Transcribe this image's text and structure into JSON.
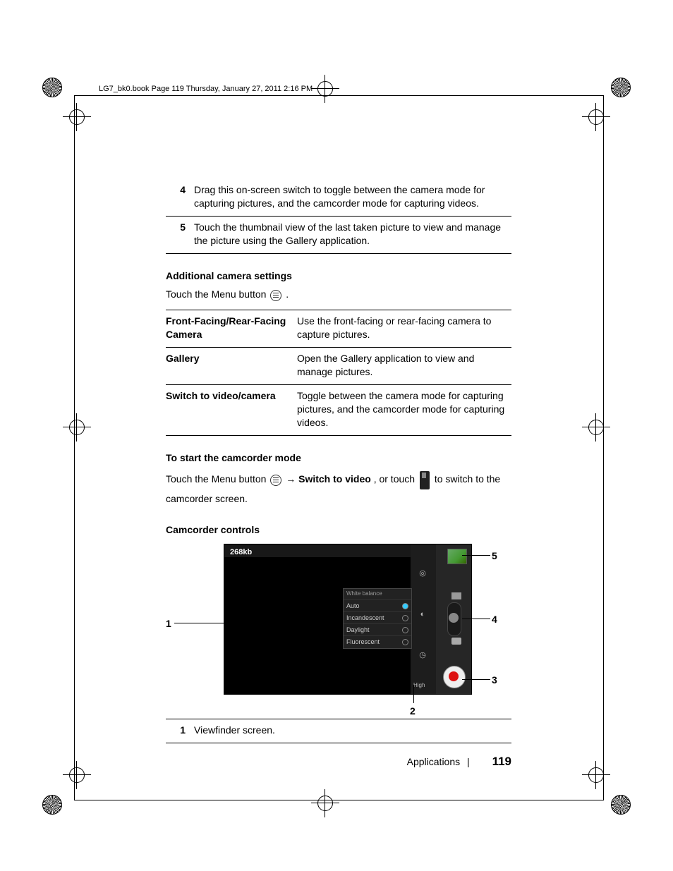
{
  "header": {
    "running_head": "LG7_bk0.book  Page 119  Thursday, January 27, 2011  2:16 PM"
  },
  "numbered": [
    {
      "n": "4",
      "text": "Drag this on-screen switch to toggle between the camera mode for capturing pictures, and the camcorder mode for capturing videos."
    },
    {
      "n": "5",
      "text": "Touch the thumbnail view of the last taken picture to view and manage the picture using the Gallery application."
    }
  ],
  "sections": {
    "additional_heading": "Additional camera settings",
    "menu_line_prefix": "Touch the Menu button ",
    "menu_line_suffix": ".",
    "settings": [
      {
        "label": "Front-Facing/Rear-Facing Camera",
        "desc": "Use the front-facing or rear-facing camera to capture pictures."
      },
      {
        "label": "Gallery",
        "desc": "Open the Gallery application to view and manage pictures."
      },
      {
        "label": "Switch to video/camera",
        "desc": "Toggle between the camera mode for capturing pictures, and the camcorder mode for capturing videos."
      }
    ],
    "start_cam_heading": "To start the camcorder mode",
    "start_cam_prefix": "Touch the Menu button ",
    "start_cam_arrow": "→ ",
    "start_cam_bold": "Switch to video",
    "start_cam_mid": ", or touch ",
    "start_cam_suffix": " to switch to the camcorder screen.",
    "camcorder_heading": "Camcorder controls"
  },
  "camcorder_ui": {
    "size_badge": "268kb",
    "popup_title": "White balance",
    "popup_items": [
      {
        "label": "Auto",
        "selected": true
      },
      {
        "label": "Incandescent",
        "selected": false
      },
      {
        "label": "Daylight",
        "selected": false
      },
      {
        "label": "Fluorescent",
        "selected": false
      }
    ],
    "quality_label": "High"
  },
  "callouts": {
    "c1": "1",
    "c2": "2",
    "c3": "3",
    "c4": "4",
    "c5": "5"
  },
  "bottom_table": [
    {
      "n": "1",
      "text": "Viewfinder screen."
    }
  ],
  "footer": {
    "chapter": "Applications",
    "sep": "|",
    "page": "119"
  }
}
